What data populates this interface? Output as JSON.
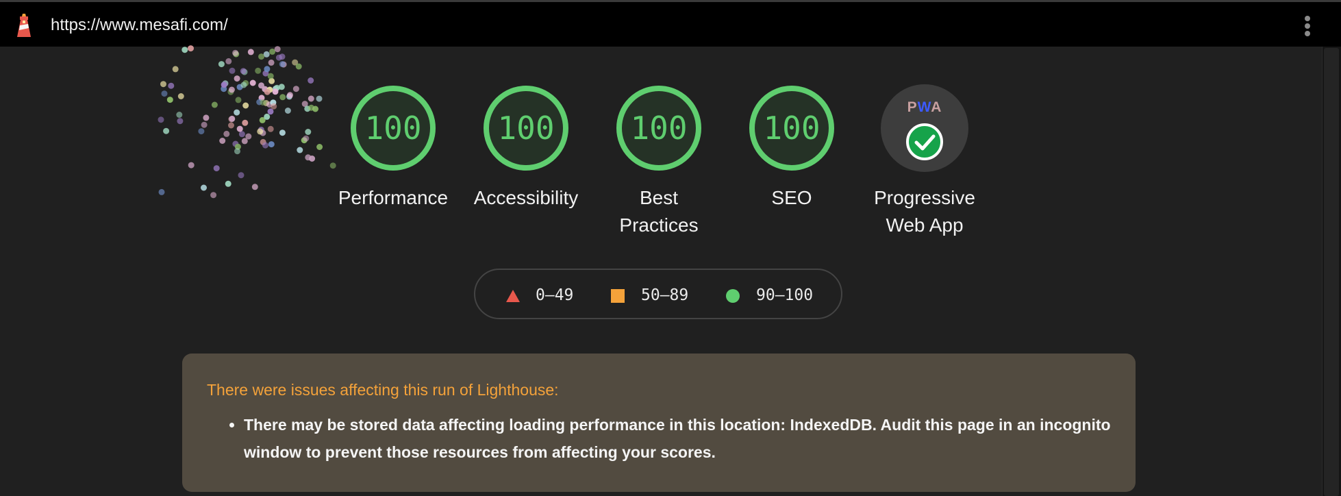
{
  "browser": {
    "url": "https://www.mesafi.com/",
    "menu_icon": "kebab-menu-icon",
    "logo_icon": "lighthouse-icon"
  },
  "colors": {
    "pass": "#5fce6f",
    "average": "#f4a23a",
    "fail": "#e8584c",
    "warning_bg": "#524b40",
    "page_bg": "#202020"
  },
  "categories": [
    {
      "label": "Performance",
      "score": "100"
    },
    {
      "label": "Accessibility",
      "score": "100"
    },
    {
      "label": "Best Practices",
      "score": "100"
    },
    {
      "label": "SEO",
      "score": "100"
    }
  ],
  "pwa": {
    "label": "Progressive Web App",
    "badge_text": "PWA",
    "badge_icon": "check-circle-icon"
  },
  "legend": {
    "fail": "0–49",
    "average": "50–89",
    "pass": "90–100"
  },
  "warning": {
    "title": "There were issues affecting this run of Lighthouse:",
    "items": [
      "There may be stored data affecting loading performance in this location: IndexedDB. Audit this page in an incognito window to prevent those resources from affecting your scores."
    ]
  }
}
